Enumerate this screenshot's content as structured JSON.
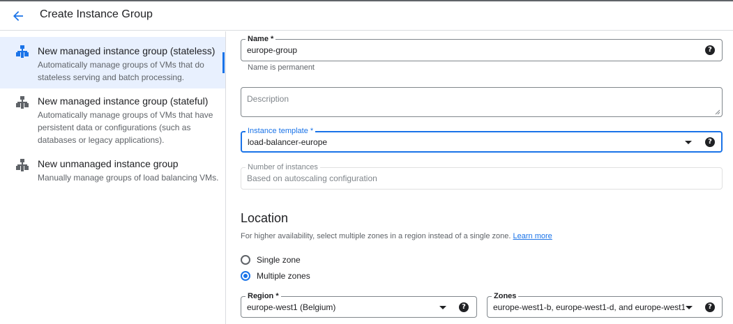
{
  "header": {
    "title": "Create Instance Group"
  },
  "sidebar": {
    "options": [
      {
        "title": "New managed instance group (stateless)",
        "description": "Automatically manage groups of VMs that do stateless serving and batch processing.",
        "selected": true
      },
      {
        "title": "New managed instance group (stateful)",
        "description": "Automatically manage groups of VMs that have persistent data or configurations (such as databases or legacy applications).",
        "selected": false
      },
      {
        "title": "New unmanaged instance group",
        "description": "Manually manage groups of load balancing VMs.",
        "selected": false
      }
    ]
  },
  "form": {
    "name": {
      "label": "Name *",
      "value": "europe-group",
      "hint": "Name is permanent"
    },
    "description": {
      "placeholder": "Description",
      "value": ""
    },
    "template": {
      "label": "Instance template *",
      "value": "load-balancer-europe"
    },
    "instances": {
      "label": "Number of instances",
      "value": "Based on autoscaling configuration"
    },
    "location": {
      "title": "Location",
      "description": "For higher availability, select multiple zones in a region instead of a single zone.",
      "learn_more": "Learn more",
      "options": [
        {
          "label": "Single zone",
          "selected": false
        },
        {
          "label": "Multiple zones",
          "selected": true
        }
      ],
      "region": {
        "label": "Region *",
        "value": "europe-west1 (Belgium)"
      },
      "zones": {
        "label": "Zones",
        "value": "europe-west1-b, europe-west1-d, and europe-west1…"
      }
    }
  },
  "colors": {
    "accent": "#1a73e8",
    "selected_bg": "#e8f0fe",
    "text": "#202124",
    "muted": "#5f6368"
  }
}
